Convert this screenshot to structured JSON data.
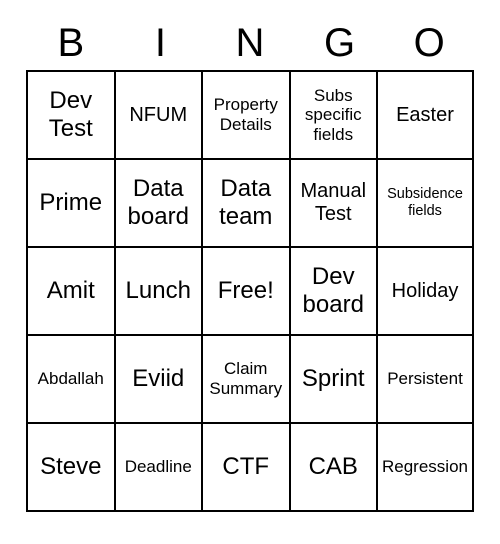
{
  "header": [
    "B",
    "I",
    "N",
    "G",
    "O"
  ],
  "grid": [
    [
      {
        "text": "Dev Test",
        "size": "fs-large"
      },
      {
        "text": "NFUM",
        "size": "fs-med"
      },
      {
        "text": "Property Details",
        "size": "fs-sm"
      },
      {
        "text": "Subs specific fields",
        "size": "fs-sm"
      },
      {
        "text": "Easter",
        "size": "fs-med"
      }
    ],
    [
      {
        "text": "Prime",
        "size": "fs-large"
      },
      {
        "text": "Data board",
        "size": "fs-large"
      },
      {
        "text": "Data team",
        "size": "fs-large"
      },
      {
        "text": "Manual Test",
        "size": "fs-med"
      },
      {
        "text": "Subsidence fields",
        "size": "fs-xs"
      }
    ],
    [
      {
        "text": "Amit",
        "size": "fs-large"
      },
      {
        "text": "Lunch",
        "size": "fs-large"
      },
      {
        "text": "Free!",
        "size": "fs-large"
      },
      {
        "text": "Dev board",
        "size": "fs-large"
      },
      {
        "text": "Holiday",
        "size": "fs-med"
      }
    ],
    [
      {
        "text": "Abdallah",
        "size": "fs-sm"
      },
      {
        "text": "Eviid",
        "size": "fs-large"
      },
      {
        "text": "Claim Summary",
        "size": "fs-sm"
      },
      {
        "text": "Sprint",
        "size": "fs-large"
      },
      {
        "text": "Persistent",
        "size": "fs-sm"
      }
    ],
    [
      {
        "text": "Steve",
        "size": "fs-large"
      },
      {
        "text": "Deadline",
        "size": "fs-sm"
      },
      {
        "text": "CTF",
        "size": "fs-large"
      },
      {
        "text": "CAB",
        "size": "fs-large"
      },
      {
        "text": "Regression",
        "size": "fs-sm"
      }
    ]
  ]
}
